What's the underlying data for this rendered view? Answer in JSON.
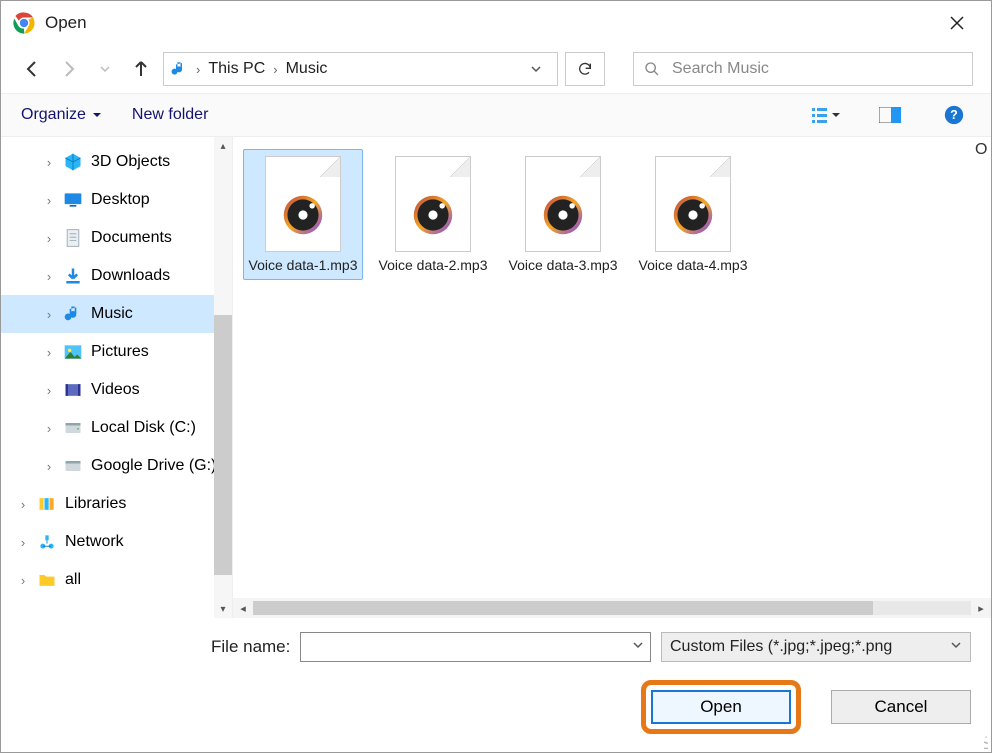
{
  "title": "Open",
  "breadcrumb": {
    "root": "This PC",
    "folder": "Music"
  },
  "search_placeholder": "Search Music",
  "toolbar": {
    "organize": "Organize",
    "newfolder": "New folder"
  },
  "tree": [
    {
      "label": "3D Objects",
      "icon": "cube",
      "indent": true
    },
    {
      "label": "Desktop",
      "icon": "desktop",
      "indent": true
    },
    {
      "label": "Documents",
      "icon": "doc",
      "indent": true
    },
    {
      "label": "Downloads",
      "icon": "download",
      "indent": true
    },
    {
      "label": "Music",
      "icon": "music",
      "indent": true,
      "selected": true
    },
    {
      "label": "Pictures",
      "icon": "pictures",
      "indent": true
    },
    {
      "label": "Videos",
      "icon": "videos",
      "indent": true
    },
    {
      "label": "Local Disk (C:)",
      "icon": "disk",
      "indent": true
    },
    {
      "label": "Google Drive (G:)",
      "icon": "gdrive",
      "indent": true
    },
    {
      "label": "Libraries",
      "icon": "libraries",
      "indent": false
    },
    {
      "label": "Network",
      "icon": "network",
      "indent": false
    },
    {
      "label": "all",
      "icon": "folder",
      "indent": false
    }
  ],
  "files": [
    {
      "name": "Voice data-1.mp3",
      "selected": true
    },
    {
      "name": "Voice data-2.mp3",
      "selected": false
    },
    {
      "name": "Voice data-3.mp3",
      "selected": false
    },
    {
      "name": "Voice data-4.mp3",
      "selected": false
    }
  ],
  "filename_label": "File name:",
  "filename_value": "",
  "filter_text": "Custom Files (*.jpg;*.jpeg;*.png",
  "open_label": "Open",
  "cancel_label": "Cancel",
  "corner_letter": "O"
}
